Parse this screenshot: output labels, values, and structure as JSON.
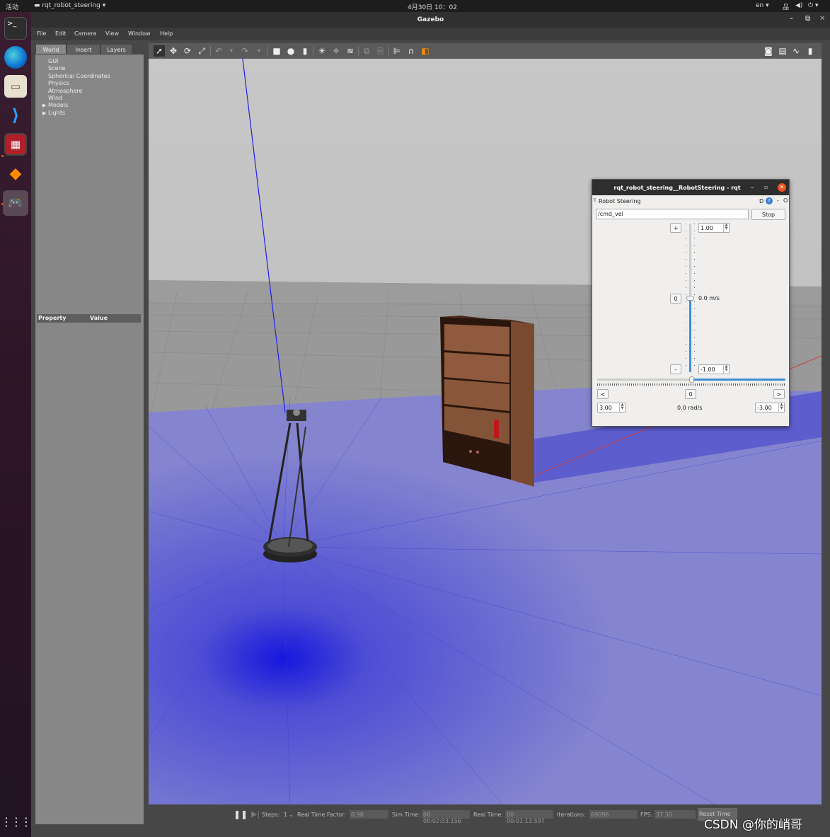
{
  "topbar": {
    "activities": "活动",
    "app_menu": "rqt_robot_steering",
    "clock": "4月30日 10：02",
    "lang": "en"
  },
  "window": {
    "title": "Gazebo"
  },
  "menu": {
    "items": [
      "File",
      "Edit",
      "Camera",
      "View",
      "Window",
      "Help"
    ]
  },
  "left_panel": {
    "tabs": [
      "World",
      "Insert",
      "Layers"
    ],
    "tree": [
      "GUI",
      "Scene",
      "Spherical Coordinates",
      "Physics",
      "Atmosphere",
      "Wind",
      "Models",
      "Lights"
    ],
    "property_header": "Property",
    "value_header": "Value"
  },
  "bottom": {
    "steps_label": "Steps:",
    "steps_value": "1",
    "rtf_label": "Real Time Factor:",
    "rtf_value": "0.98",
    "sim_label": "Sim Time:",
    "sim_value": "00 00:02:03.156",
    "real_label": "Real Time:",
    "real_value": "00 00:01:13.597",
    "iter_label": "Iterations:",
    "iter_value": "69096",
    "fps_label": "FPS:",
    "fps_value": "37.30",
    "reset_label": "Reset Time"
  },
  "rqt": {
    "title": "rqt_robot_steering__RobotSteering - rqt",
    "plugin_name": "Robot Steering",
    "plugin_controls": "D",
    "topic": "/cmd_vel",
    "stop_label": "Stop",
    "plus_label": "+",
    "minus_label": "-",
    "zero_label": "0",
    "left_label": "<",
    "right_label": ">",
    "max_linear": "1.00",
    "min_linear": "-1.00",
    "linear_readout": "0.0 m/s",
    "max_angular": "3.00",
    "min_angular": "-3.00",
    "angular_readout": "0.0 rad/s",
    "linear_value": 0.0,
    "angular_value": 0.0
  },
  "watermark": "CSDN @你的峭哥"
}
